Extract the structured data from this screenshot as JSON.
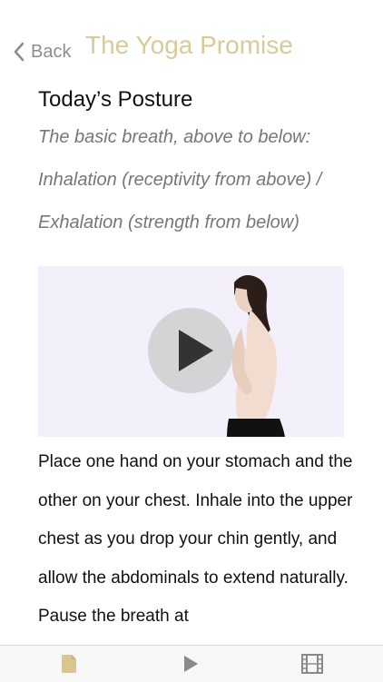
{
  "nav": {
    "back_label": "Back",
    "title": "The Yoga Promise"
  },
  "posture": {
    "heading": "Today’s Posture",
    "subtitle_lines": [
      "The basic breath, above to below:",
      "Inhalation (receptivity from above) /",
      "Exhalation (strength from below)"
    ]
  },
  "video": {
    "play_icon": "play-icon"
  },
  "instructions": {
    "text": "Place one hand on your stomach and the other on your chest. Inhale into the upper chest as you drop your chin gently, and allow the abdominals to extend naturally. Pause the breath at"
  },
  "tabbar": {
    "items": [
      {
        "icon": "document-icon",
        "color": "#d9c58f"
      },
      {
        "icon": "play-icon",
        "color": "#8a8a8a"
      },
      {
        "icon": "film-icon",
        "color": "#8a8a8a"
      }
    ]
  },
  "colors": {
    "accent": "#d9ca99",
    "back": "#8d8d8d",
    "subtitle": "#777777",
    "video_bg": "#f3f0fb"
  }
}
